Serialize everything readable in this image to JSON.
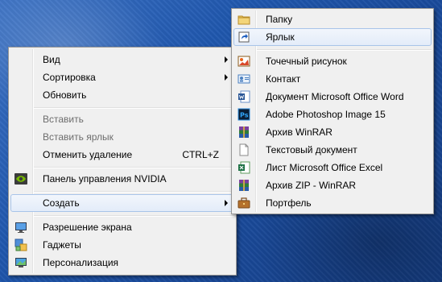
{
  "context_menu": {
    "items": [
      {
        "label": "Вид"
      },
      {
        "label": "Сортировка"
      },
      {
        "label": "Обновить"
      },
      {
        "label": "Вставить"
      },
      {
        "label": "Вставить ярлык"
      },
      {
        "label": "Отменить удаление",
        "shortcut": "CTRL+Z"
      },
      {
        "label": "Панель управления NVIDIA",
        "icon": "nvidia-icon"
      },
      {
        "label": "Создать"
      },
      {
        "label": "Разрешение экрана",
        "icon": "screen-resolution-icon"
      },
      {
        "label": "Гаджеты",
        "icon": "gadgets-icon"
      },
      {
        "label": "Персонализация",
        "icon": "personalization-icon"
      }
    ]
  },
  "create_submenu": {
    "items": [
      {
        "label": "Папку",
        "icon": "folder-icon"
      },
      {
        "label": "Ярлык",
        "icon": "shortcut-icon"
      },
      {
        "label": "Точечный рисунок",
        "icon": "bitmap-icon"
      },
      {
        "label": "Контакт",
        "icon": "contact-icon"
      },
      {
        "label": "Документ Microsoft Office Word",
        "icon": "word-icon"
      },
      {
        "label": "Adobe Photoshop Image 15",
        "icon": "photoshop-icon"
      },
      {
        "label": "Архив WinRAR",
        "icon": "winrar-icon"
      },
      {
        "label": "Текстовый документ",
        "icon": "text-document-icon"
      },
      {
        "label": "Лист Microsoft Office Excel",
        "icon": "excel-icon"
      },
      {
        "label": "Архив ZIP - WinRAR",
        "icon": "winrar-zip-icon"
      },
      {
        "label": "Портфель",
        "icon": "briefcase-icon"
      }
    ]
  },
  "colors": {
    "highlight_border": "#a8c4e9",
    "menu_background": "#f0f0f0",
    "disabled_text": "#6d6d6d"
  }
}
